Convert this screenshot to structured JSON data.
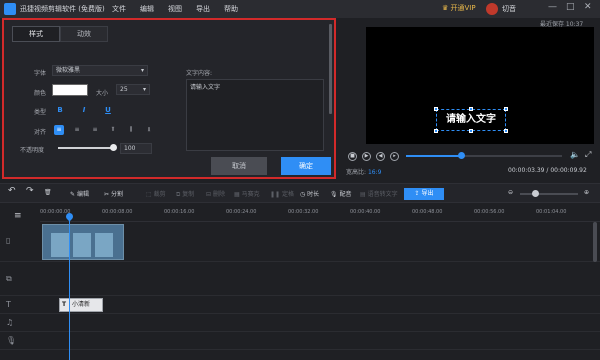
{
  "titlebar": {
    "app": "迅捷视频剪辑软件 (免费版)",
    "menu": [
      "文件",
      "编辑",
      "视图",
      "导出",
      "帮助"
    ],
    "vip": "开通VIP",
    "user": "切音",
    "controls": [
      "—",
      "□",
      "✕"
    ]
  },
  "panel": {
    "tabs": [
      "样式",
      "动效"
    ],
    "font_label": "字体",
    "font_value": "微软雅黑",
    "color_label": "颜色",
    "size_label": "大小",
    "size_value": "25",
    "type_label": "类型",
    "bold": "B",
    "italic": "I",
    "underline": "U",
    "align_label": "对齐",
    "opacity_label": "不透明度",
    "opacity_value": "100",
    "text_label": "文字内容:",
    "text_value": "请输入文字",
    "cancel": "取消",
    "ok": "确定"
  },
  "preview": {
    "autosave": "最近保存 10:37",
    "overlay": "请输入文字",
    "ratio_label": "宽高比:",
    "ratio_value": "16:9",
    "time": "00:00:03.39 / 00:00:09.92",
    "progress": 0.35
  },
  "toolbar": {
    "edit": "编辑",
    "split": "分割",
    "crop": "裁剪",
    "copy": "复制",
    "delete": "删除",
    "trim": "马赛克",
    "freeze": "定格",
    "duration": "时长",
    "dub": "配音",
    "voice": "语音转文字",
    "export": "导出"
  },
  "ruler": [
    "00:00:00.00",
    "00:00:08.00",
    "00:00:16.00",
    "00:00:24.00",
    "00:00:32.00",
    "00:00:40.00",
    "00:00:48.00",
    "00:00:56.00",
    "00:01:04.00"
  ],
  "textclip": "小清新",
  "colors": {
    "accent": "#2f8ef5",
    "highlight_border": "#d22a2a"
  }
}
